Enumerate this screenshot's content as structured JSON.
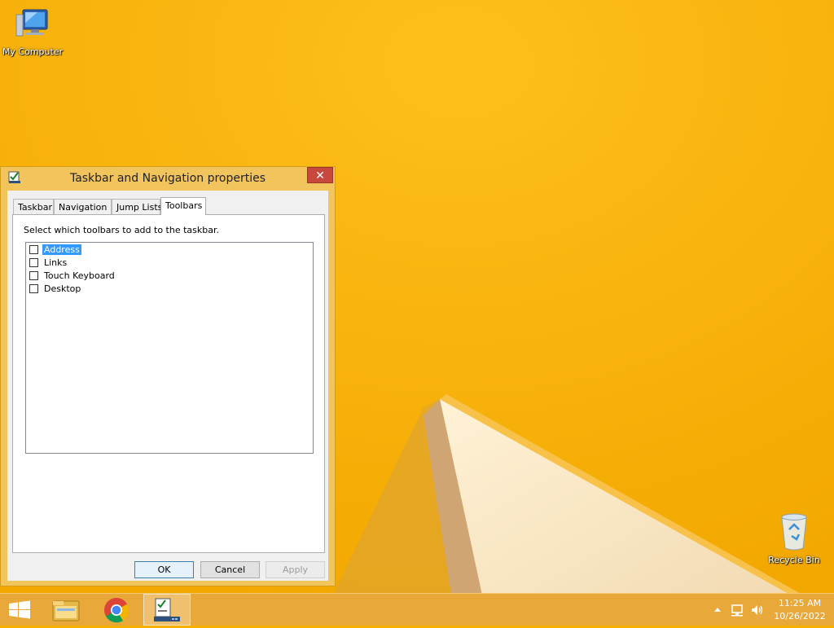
{
  "desktop": {
    "icons": [
      {
        "label": "My Computer"
      },
      {
        "label": "Recycle Bin"
      }
    ]
  },
  "dialog": {
    "title": "Taskbar and Navigation properties",
    "close_label": "✕",
    "tabs": [
      "Taskbar",
      "Navigation",
      "Jump Lists",
      "Toolbars"
    ],
    "active_tab": "Toolbars",
    "instruction": "Select which toolbars to add to the taskbar.",
    "toolbars": [
      {
        "label": "Address",
        "checked": false,
        "selected": true
      },
      {
        "label": "Links",
        "checked": false,
        "selected": false
      },
      {
        "label": "Touch Keyboard",
        "checked": false,
        "selected": false
      },
      {
        "label": "Desktop",
        "checked": false,
        "selected": false
      }
    ],
    "buttons": {
      "ok": "OK",
      "cancel": "Cancel",
      "apply": "Apply"
    }
  },
  "taskbar": {
    "items": [
      "start-button",
      "file-explorer",
      "google-chrome",
      "taskbar-properties"
    ],
    "tray": {
      "show_hidden_icon": "chevron-up-icon",
      "network_icon": "network-icon",
      "volume_icon": "speaker-icon"
    },
    "clock": {
      "time": "11:25 AM",
      "date": "10/26/2022"
    }
  },
  "colors": {
    "wallpaper": "#f6b000",
    "selection": "#3399ff",
    "close_button": "#c7483c",
    "taskbar": "#e8a83a"
  }
}
